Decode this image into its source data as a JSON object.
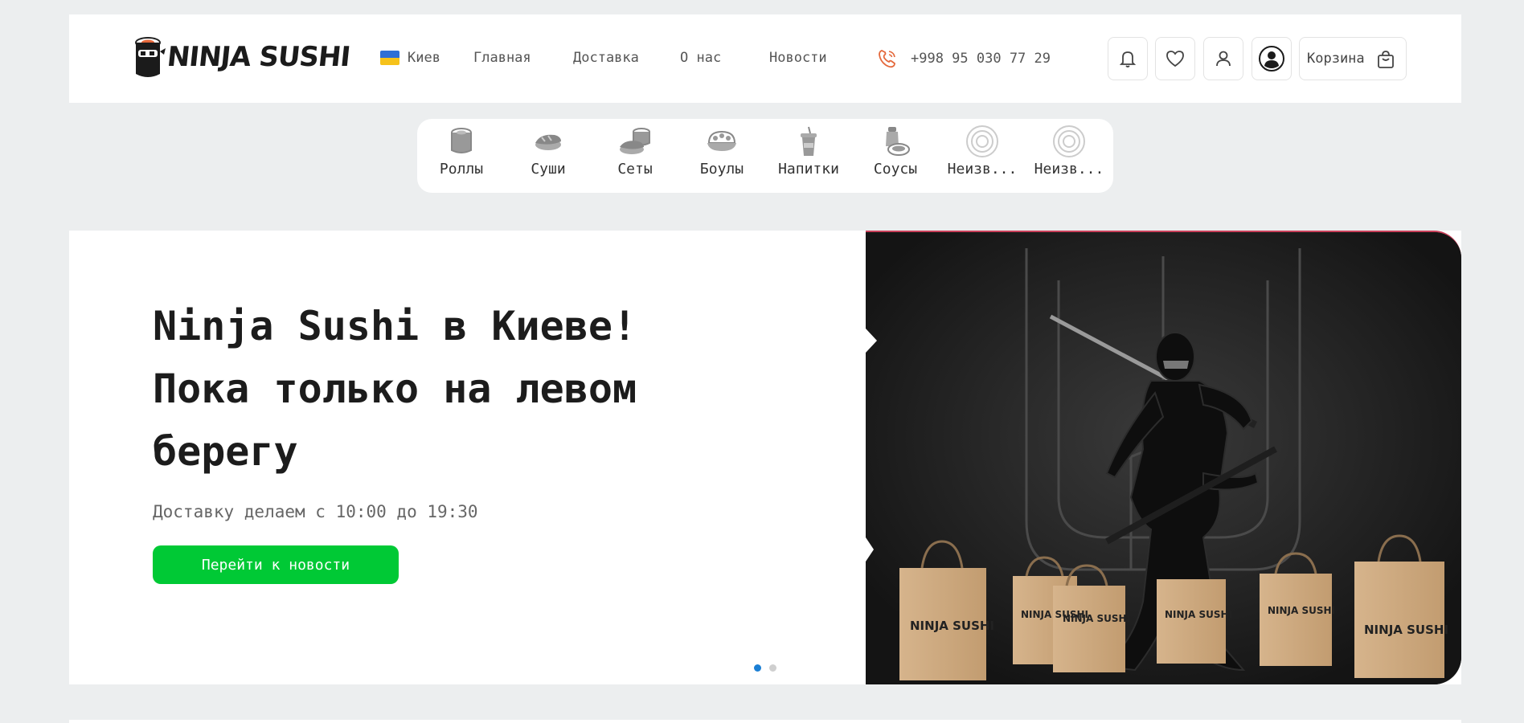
{
  "header": {
    "logo_text": "NINJA SUSHI",
    "city": "Киев",
    "nav": [
      "Главная",
      "Доставка",
      "О нас",
      "Новости"
    ],
    "phone": "+998 95 030 77 29",
    "cart_label": "Корзина",
    "icons": [
      "bell-icon",
      "heart-icon",
      "user-icon",
      "account-icon",
      "cart-icon"
    ]
  },
  "categories": [
    {
      "label": "Роллы",
      "icon": "roll-icon"
    },
    {
      "label": "Суши",
      "icon": "sushi-icon"
    },
    {
      "label": "Сеты",
      "icon": "set-icon"
    },
    {
      "label": "Боулы",
      "icon": "bowl-icon"
    },
    {
      "label": "Напитки",
      "icon": "drink-icon"
    },
    {
      "label": "Соусы",
      "icon": "sauce-icon"
    },
    {
      "label": "Неизв...",
      "icon": "placeholder-icon"
    },
    {
      "label": "Неизв...",
      "icon": "placeholder-icon"
    }
  ],
  "hero": {
    "title_lines": [
      "Ninja Sushi в Киеве!",
      "Пока только на левом",
      "берегу"
    ],
    "subtitle": "Доставку делаем с 10:00 до 19:30",
    "button": "Перейти к новости",
    "slides_total": 2,
    "active_slide": 1,
    "bag_label": "NINJA SUSHI"
  },
  "colors": {
    "accent_green": "#00c935",
    "phone_orange": "#e4683b",
    "dot_active": "#1b7fd4",
    "page_bg": "#eceeef"
  }
}
